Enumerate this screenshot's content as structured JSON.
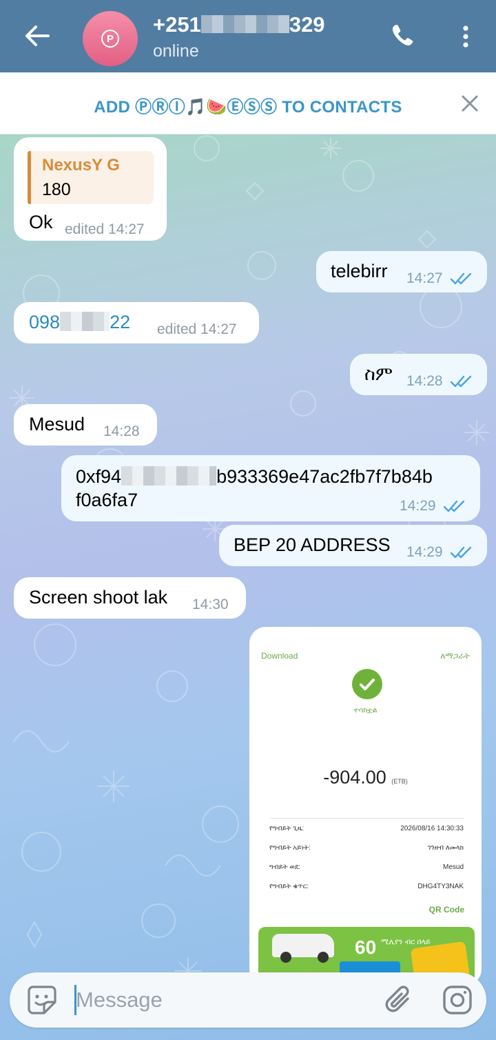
{
  "header": {
    "back_icon": "arrow-left-icon",
    "avatar_glyph": "P",
    "name_prefix": "+251",
    "name_suffix": "329",
    "status": "online",
    "call_icon": "phone-icon",
    "menu_icon": "more-vertical-icon"
  },
  "add_contact": {
    "label": "ADD ⓅⓇⒾ🎵🍉ⒺⓈⓈ TO CONTACTS",
    "close_icon": "close-icon"
  },
  "messages": [
    {
      "dir": "in",
      "reply_name": "NexusY G",
      "reply_text": "180",
      "text": "Ok",
      "meta": "edited 14:27"
    },
    {
      "dir": "out",
      "text": "telebirr",
      "meta": "14:27"
    },
    {
      "dir": "in",
      "text_prefix": "098",
      "text_suffix": "22",
      "meta": "edited 14:27"
    },
    {
      "dir": "out",
      "text": "ስም",
      "meta": "14:28"
    },
    {
      "dir": "in",
      "text": "Mesud",
      "meta": "14:28"
    },
    {
      "dir": "out",
      "text_line1_prefix": "0xf94",
      "text_line1_suffix": "b933369e47ac2fb7f7b84b",
      "text_line2": "f0a6fa7",
      "meta": "14:29"
    },
    {
      "dir": "out",
      "text": "BEP 20 ADDRESS",
      "meta": "14:29"
    },
    {
      "dir": "in",
      "text": "Screen shoot lak",
      "meta": "14:30"
    }
  ],
  "receipt_photo": {
    "download": "Download",
    "share": "ለማጋራት",
    "status": "ተሳክቷል",
    "amount": "-904.00",
    "currency": "(ETB)",
    "rows": [
      {
        "k": "የግብይት ጊዜ:",
        "v": "2026/08/16 14:30:33"
      },
      {
        "k": "የግብይት አይነት:",
        "v": "ገንዘብ ለመላክ"
      },
      {
        "k": "ግብይት ወደ:",
        "v": "Mesud"
      },
      {
        "k": "የግብይት ቁጥር:",
        "v": "DHG4TY3NAK"
      }
    ],
    "qr": "QR Code",
    "banner_big": "60",
    "banner_text": "ሚሊየን ብር በላይ"
  },
  "composer": {
    "placeholder": "Message",
    "sticker_icon": "sticker-smile-icon",
    "attach_icon": "paperclip-icon",
    "camera_icon": "camera-icon"
  },
  "colors": {
    "header": "#517da2",
    "accent": "#3a95c9",
    "check": "#4aa3df",
    "reply": "#d98b3a"
  }
}
